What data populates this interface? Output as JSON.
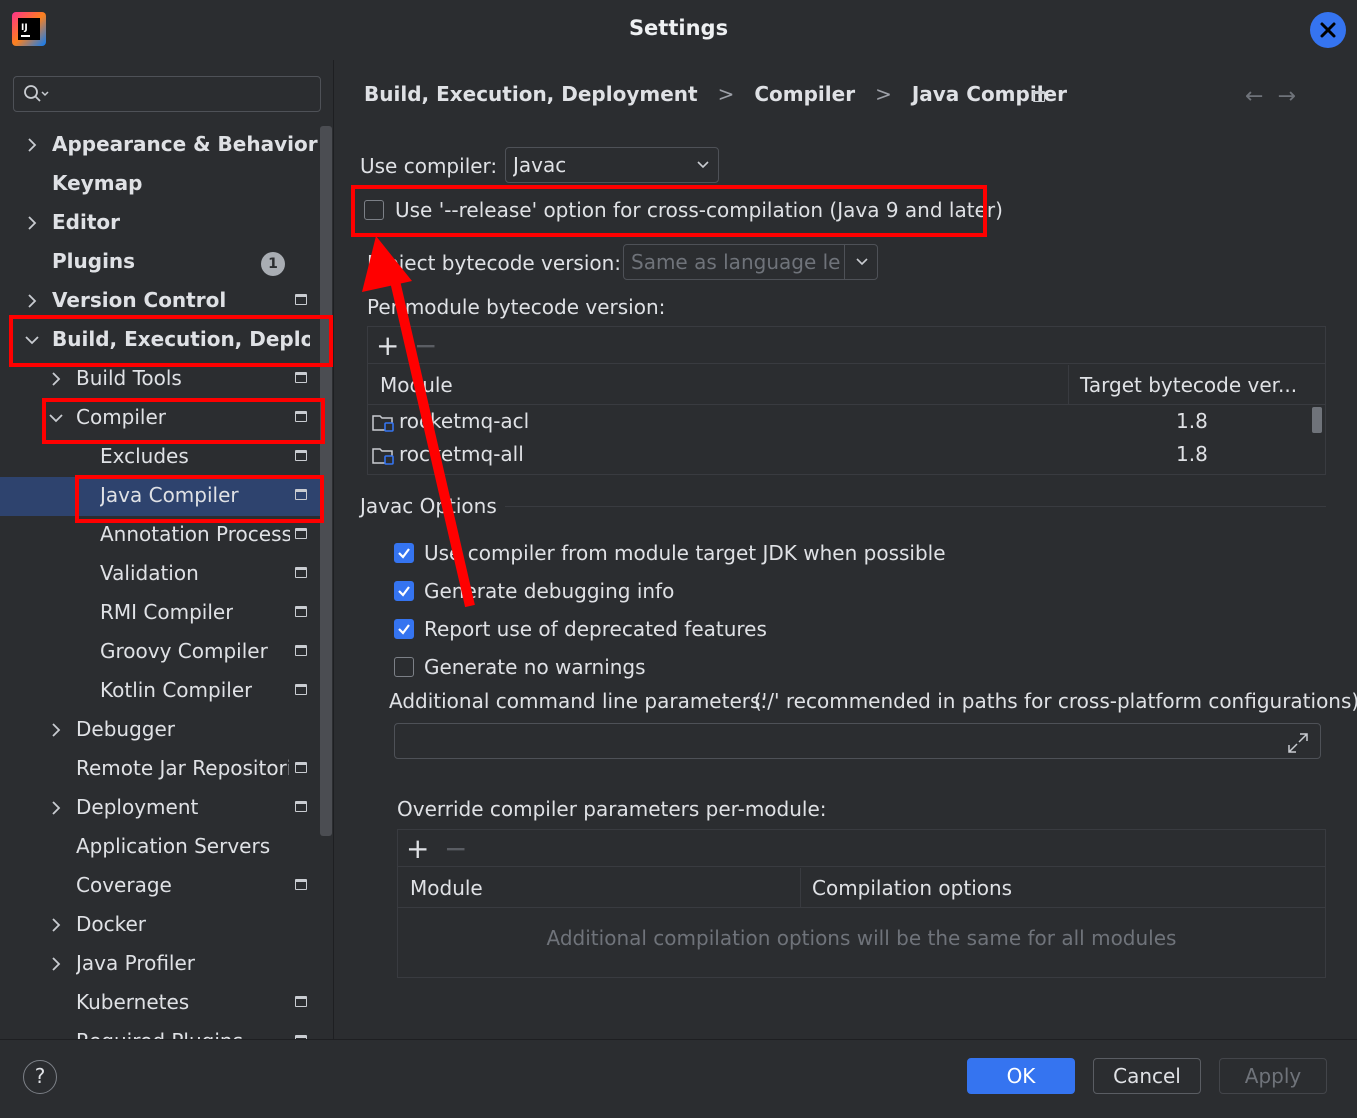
{
  "window": {
    "title": "Settings",
    "app_icon": "intellij-idea-icon",
    "close_icon": "close-icon"
  },
  "sidebar": {
    "search_icon": "search-icon",
    "items": [
      {
        "label": "Appearance & Behavior",
        "expandable": true,
        "expanded": false
      },
      {
        "label": "Keymap",
        "expandable": false
      },
      {
        "label": "Editor",
        "expandable": true,
        "expanded": false
      },
      {
        "label": "Plugins",
        "expandable": false,
        "badge": "1"
      },
      {
        "label": "Version Control",
        "expandable": true,
        "expanded": false
      },
      {
        "label": "Build, Execution, Deployment",
        "expandable": true,
        "expanded": true
      },
      {
        "label": "Build Tools",
        "expandable": true,
        "expanded": false
      },
      {
        "label": "Compiler",
        "expandable": true,
        "expanded": true
      },
      {
        "label": "Excludes"
      },
      {
        "label": "Java Compiler",
        "selected": true
      },
      {
        "label": "Annotation Processors"
      },
      {
        "label": "Validation"
      },
      {
        "label": "RMI Compiler"
      },
      {
        "label": "Groovy Compiler"
      },
      {
        "label": "Kotlin Compiler"
      },
      {
        "label": "Debugger",
        "expandable": true,
        "expanded": false
      },
      {
        "label": "Remote Jar Repositories"
      },
      {
        "label": "Deployment",
        "expandable": true,
        "expanded": false
      },
      {
        "label": "Application Servers"
      },
      {
        "label": "Coverage"
      },
      {
        "label": "Docker",
        "expandable": true,
        "expanded": false
      },
      {
        "label": "Java Profiler",
        "expandable": true,
        "expanded": false
      },
      {
        "label": "Kubernetes"
      },
      {
        "label": "Required Plugins"
      }
    ]
  },
  "breadcrumb": {
    "parts": [
      "Build, Execution, Deployment",
      "Compiler",
      "Java Compiler"
    ],
    "separator": ">",
    "back_arrow": "←",
    "forward_arrow": "→"
  },
  "compiler": {
    "use_compiler_label": "Use compiler:",
    "use_compiler_value": "Javac",
    "release_option_label": "Use '--release' option for cross-compilation (Java 9 and later)",
    "release_option_checked": false,
    "project_bytecode_label": "Project bytecode version:",
    "project_bytecode_value": "Same as language level",
    "per_module_label": "Per-module bytecode version:",
    "per_module_table": {
      "add": "+",
      "remove": "−",
      "columns": [
        "Module",
        "Target bytecode ver..."
      ],
      "rows": [
        {
          "module": "rocketmq-acl",
          "target": "1.8"
        },
        {
          "module": "rocketmq-all",
          "target": "1.8"
        }
      ]
    }
  },
  "javac": {
    "section_title": "Javac Options",
    "options": [
      {
        "label": "Use compiler from module target JDK when possible",
        "checked": true
      },
      {
        "label": "Generate debugging info",
        "checked": true
      },
      {
        "label": "Report use of deprecated features",
        "checked": true
      },
      {
        "label": "Generate no warnings",
        "checked": false
      }
    ],
    "additional_params_label": "Additional command line parameters:",
    "additional_params_hint": "('/' recommended in paths for cross-platform configurations)",
    "additional_params_value": "",
    "override_label": "Override compiler parameters per-module:",
    "override_table": {
      "add": "+",
      "remove": "−",
      "columns": [
        "Module",
        "Compilation options"
      ],
      "empty_text": "Additional compilation options will be the same for all modules"
    }
  },
  "footer": {
    "help": "?",
    "ok": "OK",
    "cancel": "Cancel",
    "apply": "Apply"
  },
  "colors": {
    "background": "#2b2d30",
    "accent": "#3574f0",
    "selection": "#2e436e",
    "annotation": "#ff0000"
  }
}
